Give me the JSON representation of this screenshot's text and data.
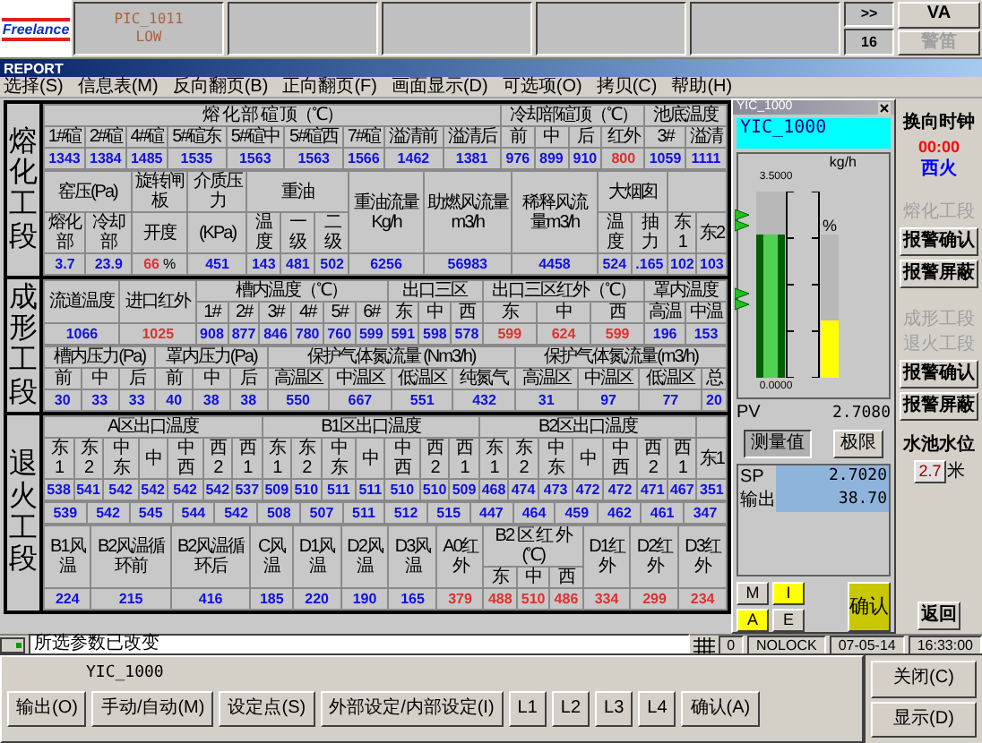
{
  "alarm_strip": {
    "logo": "Freelance",
    "alarms": [
      {
        "tag": "PIC_1011",
        "state": "LOW"
      }
    ],
    "more": ">>",
    "count": "16",
    "horn_buttons": [
      {
        "label": "VA",
        "disabled": false
      },
      {
        "label": "警笛",
        "disabled": true
      }
    ]
  },
  "window": {
    "title": "REPORT"
  },
  "menu": [
    "选择(S)",
    "信息表(M)",
    "反向翻页(B)",
    "正向翻页(F)",
    "画面显示(D)",
    "可选项(O)",
    "拷贝(C)",
    "帮助(H)"
  ],
  "sections": [
    {
      "label": "熔化工段",
      "bands": [
        {
          "groups": [
            {
              "title": "熔 化 部 碹 顶（℃）",
              "columns": [
                "1#碹",
                "2#碹",
                "4#碹",
                "5#碹东",
                "5#碹中",
                "5#碹西",
                "7#碹",
                "溢清前",
                "溢清后"
              ]
            },
            {
              "title": "冷却部碹顶（℃）",
              "columns": [
                "前",
                "中",
                "后",
                "红外"
              ]
            },
            {
              "title": "池底温度",
              "columns": [
                "3#",
                "溢清"
              ]
            }
          ],
          "values": [
            {
              "text": "1343",
              "kind": "value"
            },
            {
              "text": "1384",
              "kind": "value"
            },
            {
              "text": "1485",
              "kind": "value"
            },
            {
              "text": "1535",
              "kind": "value"
            },
            {
              "text": "1563",
              "kind": "value"
            },
            {
              "text": "1563",
              "kind": "value"
            },
            {
              "text": "1566",
              "kind": "value"
            },
            {
              "text": "1462",
              "kind": "value"
            },
            {
              "text": "1381",
              "kind": "value"
            },
            {
              "text": "976",
              "kind": "value"
            },
            {
              "text": "899",
              "kind": "value"
            },
            {
              "text": "910",
              "kind": "value"
            },
            {
              "text": "800",
              "kind": "alarm"
            },
            {
              "text": "1059",
              "kind": "value"
            },
            {
              "text": "1111",
              "kind": "value"
            }
          ]
        },
        {
          "groups": [
            {
              "title": "窑压(Pa)",
              "columns": [
                "熔化部",
                "冷却部"
              ]
            },
            {
              "title": "旋转闸板",
              "columns": [
                "开度"
              ]
            },
            {
              "title": "介质压力",
              "columns": [
                "(KPa)"
              ]
            },
            {
              "title": "重油",
              "columns": [
                "温度",
                "一级",
                "二级"
              ]
            },
            {
              "title": "重油流量Kg/h"
            },
            {
              "title": "助燃风流量m3/h"
            },
            {
              "title": "稀释风流量m3/h"
            },
            {
              "title": "大烟囱",
              "columns": [
                "温度",
                "抽力"
              ]
            },
            {
              "columns": [
                "东1",
                "东2"
              ]
            }
          ],
          "values": [
            {
              "text": "3.7",
              "kind": "value"
            },
            {
              "text": "23.9",
              "kind": "value"
            },
            {
              "text": "66",
              "unit": "%",
              "kind": "alarm"
            },
            {
              "text": "451",
              "kind": "value"
            },
            {
              "text": "143",
              "kind": "value"
            },
            {
              "text": "481",
              "kind": "value"
            },
            {
              "text": "502",
              "kind": "value"
            },
            {
              "text": "6256",
              "kind": "value"
            },
            {
              "text": "56983",
              "kind": "value"
            },
            {
              "text": "4458",
              "kind": "value"
            },
            {
              "text": "524",
              "kind": "value"
            },
            {
              "text": ".165",
              "kind": "value"
            },
            {
              "text": "102",
              "kind": "value"
            },
            {
              "text": "103",
              "kind": "value"
            }
          ]
        }
      ]
    },
    {
      "label": "成形工段",
      "bands": [
        {
          "groups": [
            {
              "title": "流道温度"
            },
            {
              "title": "进口红外"
            },
            {
              "title": "槽内温度（℃）",
              "columns": [
                "1#",
                "2#",
                "3#",
                "4#",
                "5#",
                "6#"
              ]
            },
            {
              "title": "出口三区",
              "columns": [
                "东",
                "中",
                "西"
              ]
            },
            {
              "title": "出口三区红外（℃）",
              "columns": [
                "东",
                "中",
                "西"
              ]
            },
            {
              "title": "罩内温度",
              "columns": [
                "高温",
                "中温"
              ]
            }
          ],
          "values": [
            {
              "text": "1066",
              "kind": "value"
            },
            {
              "text": "1025",
              "kind": "alarm"
            },
            {
              "text": "908",
              "kind": "value"
            },
            {
              "text": "877",
              "kind": "value"
            },
            {
              "text": "846",
              "kind": "value"
            },
            {
              "text": "780",
              "kind": "value"
            },
            {
              "text": "760",
              "kind": "value"
            },
            {
              "text": "599",
              "kind": "value"
            },
            {
              "text": "591",
              "kind": "value"
            },
            {
              "text": "598",
              "kind": "value"
            },
            {
              "text": "578",
              "kind": "value"
            },
            {
              "text": "599",
              "kind": "alarm"
            },
            {
              "text": "624",
              "kind": "alarm"
            },
            {
              "text": "599",
              "kind": "alarm"
            },
            {
              "text": "196",
              "kind": "value"
            },
            {
              "text": "153",
              "kind": "value"
            }
          ]
        },
        {
          "groups": [
            {
              "title": "槽内压力(Pa)",
              "columns": [
                "前",
                "中",
                "后"
              ]
            },
            {
              "title": "罩内压力(Pa)",
              "columns": [
                "前",
                "中",
                "后"
              ]
            },
            {
              "title": "保护气体氮流量 (Nm3/h)",
              "columns": [
                "高温区",
                "中温区",
                "低温区",
                "纯氮气"
              ]
            },
            {
              "title": "保护气体氮流量(m3/h)",
              "columns": [
                "高温区",
                "中温区",
                "低温区",
                "总"
              ]
            }
          ],
          "values": [
            {
              "text": "30",
              "kind": "value"
            },
            {
              "text": "33",
              "kind": "value"
            },
            {
              "text": "33",
              "kind": "value"
            },
            {
              "text": "40",
              "kind": "value"
            },
            {
              "text": "38",
              "kind": "value"
            },
            {
              "text": "38",
              "kind": "value"
            },
            {
              "text": "550",
              "kind": "value"
            },
            {
              "text": "667",
              "kind": "value"
            },
            {
              "text": "551",
              "kind": "value"
            },
            {
              "text": "432",
              "kind": "value"
            },
            {
              "text": "31",
              "kind": "value"
            },
            {
              "text": "97",
              "kind": "value"
            },
            {
              "text": "77",
              "kind": "value"
            },
            {
              "text": "20",
              "kind": "value"
            }
          ]
        }
      ]
    },
    {
      "label": "退火工段",
      "bands": [
        {
          "groups": [
            {
              "title": "A区出口温度",
              "columns": [
                "东1",
                "东2",
                "中东",
                "中",
                "中西",
                "西2",
                "西1"
              ]
            },
            {
              "title": "B1区出口温度",
              "columns": [
                "东1",
                "东2",
                "中东",
                "中",
                "中西",
                "西2",
                "西1"
              ]
            },
            {
              "title": "B2区出口温度",
              "columns": [
                "东1",
                "东2",
                "中东",
                "中",
                "中西",
                "西2",
                "西1"
              ]
            },
            {
              "columns": [
                "东1"
              ]
            }
          ],
          "values": [
            {
              "text": "538",
              "kind": "value"
            },
            {
              "text": "541",
              "kind": "value"
            },
            {
              "text": "542",
              "kind": "value"
            },
            {
              "text": "542",
              "kind": "value"
            },
            {
              "text": "542",
              "kind": "value"
            },
            {
              "text": "542",
              "kind": "value"
            },
            {
              "text": "537",
              "kind": "value"
            },
            {
              "text": "509",
              "kind": "value"
            },
            {
              "text": "510",
              "kind": "value"
            },
            {
              "text": "511",
              "kind": "value"
            },
            {
              "text": "511",
              "kind": "value"
            },
            {
              "text": "510",
              "kind": "value"
            },
            {
              "text": "510",
              "kind": "value"
            },
            {
              "text": "509",
              "kind": "value"
            },
            {
              "text": "468",
              "kind": "value"
            },
            {
              "text": "474",
              "kind": "value"
            },
            {
              "text": "473",
              "kind": "value"
            },
            {
              "text": "472",
              "kind": "value"
            },
            {
              "text": "472",
              "kind": "value"
            },
            {
              "text": "471",
              "kind": "value"
            },
            {
              "text": "467",
              "kind": "value"
            },
            {
              "text": "351",
              "kind": "value"
            }
          ]
        },
        {
          "values": [
            {
              "text": "539",
              "kind": "value"
            },
            {
              "text": "542",
              "kind": "value"
            },
            {
              "text": "545",
              "kind": "value"
            },
            {
              "text": "544",
              "kind": "value"
            },
            {
              "text": "542",
              "kind": "value"
            },
            {
              "text": "508",
              "kind": "value"
            },
            {
              "text": "507",
              "kind": "value"
            },
            {
              "text": "511",
              "kind": "value"
            },
            {
              "text": "512",
              "kind": "value"
            },
            {
              "text": "515",
              "kind": "value"
            },
            {
              "text": "447",
              "kind": "value"
            },
            {
              "text": "464",
              "kind": "value"
            },
            {
              "text": "459",
              "kind": "value"
            },
            {
              "text": "462",
              "kind": "value"
            },
            {
              "text": "461",
              "kind": "value"
            },
            {
              "text": "347",
              "kind": "value"
            }
          ]
        },
        {
          "groups": [
            {
              "title": "B1风温"
            },
            {
              "title": "B2风温循环前"
            },
            {
              "title": "B2风温循环后"
            },
            {
              "title": "C风温"
            },
            {
              "title": "D1风温"
            },
            {
              "title": "D2风温"
            },
            {
              "title": "D3风温"
            },
            {
              "title": "A0红外"
            },
            {
              "title": "B2 区 红 外(℃)",
              "columns": [
                "东",
                "中",
                "西"
              ]
            },
            {
              "title": "D1红外"
            },
            {
              "title": "D2红外"
            },
            {
              "title": "D3红外"
            }
          ],
          "values": [
            {
              "text": "224",
              "kind": "value"
            },
            {
              "text": "215",
              "kind": "value"
            },
            {
              "text": "416",
              "kind": "value"
            },
            {
              "text": "185",
              "kind": "value"
            },
            {
              "text": "220",
              "kind": "value"
            },
            {
              "text": "190",
              "kind": "value"
            },
            {
              "text": "165",
              "kind": "value"
            },
            {
              "text": "379",
              "kind": "alarm"
            },
            {
              "text": "488",
              "kind": "alarm"
            },
            {
              "text": "510",
              "kind": "alarm"
            },
            {
              "text": "486",
              "kind": "alarm"
            },
            {
              "text": "334",
              "kind": "alarm"
            },
            {
              "text": "299",
              "kind": "alarm"
            },
            {
              "text": "234",
              "kind": "alarm"
            }
          ]
        }
      ]
    }
  ],
  "faceplate": {
    "title": "YIC_1000",
    "tag": "YIC_1000",
    "unit": "kg/h",
    "scale_max": "3.5000",
    "scale_min": "0.0000",
    "output_unit": "%",
    "pv_bar": {
      "level": 0.77
    },
    "output_bar": {
      "level": 0.4
    },
    "pv": {
      "label": "PV",
      "value": "2.7080"
    },
    "view_buttons": [
      {
        "label": "测量值",
        "selected": true
      },
      {
        "label": "极限",
        "selected": false
      }
    ],
    "sp": {
      "label": "SP",
      "value": "2.7020"
    },
    "output": {
      "label": "输出",
      "value": "38.70"
    },
    "mode_buttons": [
      {
        "label": "M",
        "on": false
      },
      {
        "label": "I",
        "on": true
      },
      {
        "label": "A",
        "on": true
      },
      {
        "label": "E",
        "on": false
      }
    ],
    "confirm": "确认"
  },
  "side_panel": {
    "clock_label": "换向时钟",
    "clock_time": "00:00",
    "fire": "西火",
    "alarm_groups": [
      {
        "sections": [
          "熔化工段"
        ],
        "ack": "报警确认",
        "mute": "报警屏蔽"
      },
      {
        "sections": [
          "成形工段",
          "退火工段"
        ],
        "ack": "报警确认",
        "mute": "报警屏蔽"
      }
    ],
    "pool_label": "水池水位",
    "pool_value": "2.7",
    "pool_unit": "米",
    "back": "返回"
  },
  "status_bar": {
    "message": "所选参数已改变",
    "fields": [
      "0",
      "NOLOCK",
      "07-05-14",
      "16:33:00"
    ]
  },
  "bottom": {
    "tag": "YIC_1000",
    "buttons": [
      "输出(O)",
      "手动/自动(M)",
      "设定点(S)",
      "外部设定/内部设定(I)",
      "L1",
      "L2",
      "L3",
      "L4",
      "确认(A)"
    ],
    "side_buttons": [
      "关闭(C)",
      "显示(D)"
    ]
  }
}
